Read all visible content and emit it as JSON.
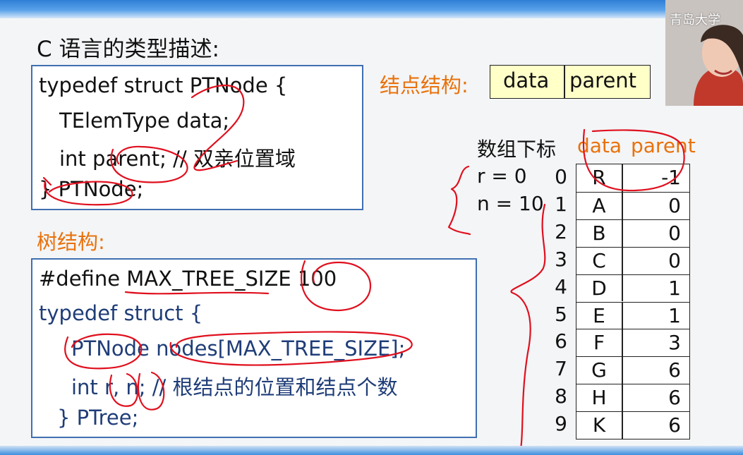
{
  "heading": "C 语言的类型描述:",
  "node_struct": {
    "lines": [
      "typedef struct PTNode {",
      "TElemType  data;",
      "int    parent;   // 双亲位置域",
      "} PTNode;"
    ]
  },
  "node_structure": {
    "label": "结点结构:",
    "fields": [
      "data",
      "parent"
    ]
  },
  "tree_label": "树结构:",
  "tree_struct": {
    "lines": [
      "#define MAX_TREE_SIZE  100",
      "typedef struct {",
      "PTNode  nodes[MAX_TREE_SIZE];",
      "int    r, n;      // 根结点的位置和结点个数",
      "} PTree;"
    ]
  },
  "array": {
    "index_header": "数组下标",
    "data_header": "data",
    "parent_header": "parent",
    "r_label": "r = 0",
    "n_label": "n = 10",
    "rows": [
      {
        "index": "0",
        "data": "R",
        "parent": "-1"
      },
      {
        "index": "1",
        "data": "A",
        "parent": "0"
      },
      {
        "index": "2",
        "data": "B",
        "parent": "0"
      },
      {
        "index": "3",
        "data": "C",
        "parent": "0"
      },
      {
        "index": "4",
        "data": "D",
        "parent": "1"
      },
      {
        "index": "5",
        "data": "E",
        "parent": "1"
      },
      {
        "index": "6",
        "data": "F",
        "parent": "3"
      },
      {
        "index": "7",
        "data": "G",
        "parent": "6"
      },
      {
        "index": "8",
        "data": "H",
        "parent": "6"
      },
      {
        "index": "9",
        "data": "K",
        "parent": "6"
      }
    ]
  },
  "webcam": {
    "label": "青岛大学"
  },
  "colors": {
    "accent": "#e8720c",
    "code_blue": "#1f3d78",
    "box_border": "#3f6fb0",
    "ink": "#e0101e",
    "field_fill": "#ffffc8"
  }
}
